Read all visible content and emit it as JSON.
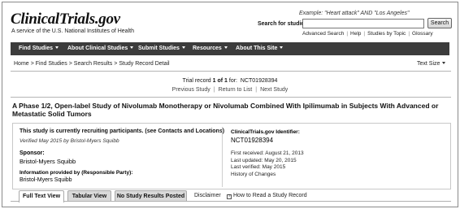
{
  "header": {
    "logo": "ClinicalTrials.gov",
    "tagline": "A service of the U.S. National Institutes of Health",
    "search_example": "Example: \"Heart attack\" AND \"Los Angeles\"",
    "search_label": "Search for studies:",
    "search_value": "",
    "search_button": "Search",
    "links": [
      "Advanced Search",
      "Help",
      "Studies by Topic",
      "Glossary"
    ]
  },
  "nav": {
    "items": [
      "Find Studies",
      "About Clinical Studies",
      "Submit Studies",
      "Resources",
      "About This Site"
    ]
  },
  "breadcrumb": {
    "items": [
      "Home",
      "Find Studies",
      "Search Results",
      "Study Record Detail"
    ],
    "text_size": "Text Size"
  },
  "record": {
    "prefix": "Trial record",
    "position": "1 of 1",
    "for_label": "for:",
    "id": "NCT01928394",
    "previous": "Previous Study",
    "return": "Return to List",
    "next": "Next Study"
  },
  "study": {
    "title": "A Phase 1/2, Open-label Study of Nivolumab Monotherapy or Nivolumab Combined With Ipilimumab in Subjects With Advanced or Metastatic Solid Tumors",
    "status": "This study is currently recruiting participants. (see Contacts and Locations)",
    "verified": "Verified May 2015 by Bristol-Myers Squibb",
    "sponsor_label": "Sponsor:",
    "sponsor": "Bristol-Myers Squibb",
    "info_label": "Information provided by (Responsible Party):",
    "info": "Bristol-Myers Squibb",
    "identifier_label": "ClinicalTrials.gov Identifier:",
    "identifier": "NCT01928394",
    "first_received": "First received: August 21, 2013",
    "last_updated": "Last updated: May 20, 2015",
    "last_verified": "Last verified: May 2015",
    "history": "History of Changes"
  },
  "tabs": {
    "full_text": "Full Text View",
    "tabular": "Tabular View",
    "no_results": "No Study Results Posted",
    "disclaimer": "Disclaimer",
    "how_to": "How to Read a Study Record",
    "help_glyph": "?"
  }
}
